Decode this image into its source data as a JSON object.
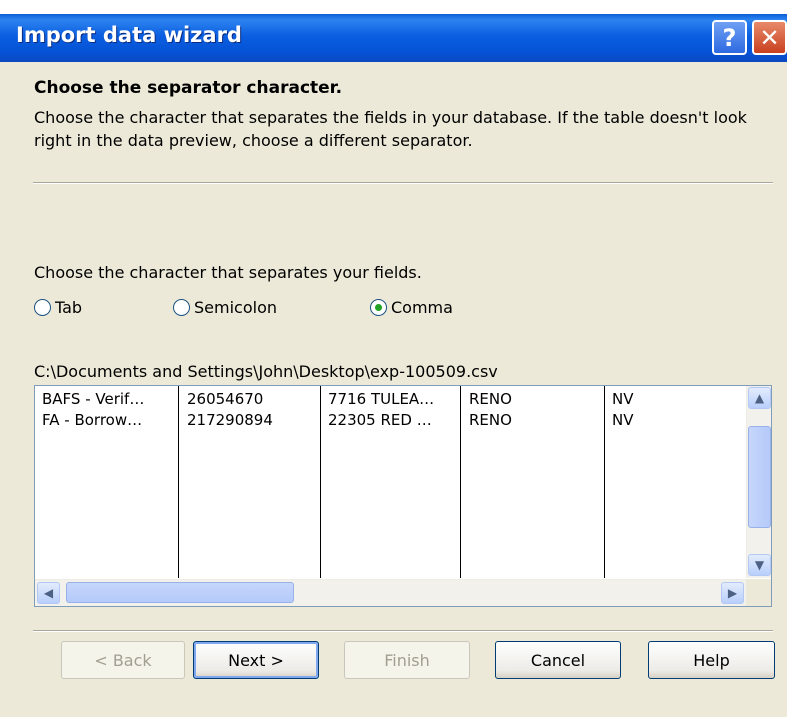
{
  "window": {
    "title": "Import data wizard",
    "help_glyph": "?",
    "close_glyph": "✕",
    "help_icon": "help-icon",
    "close_icon": "close-icon"
  },
  "header": {
    "heading": "Choose the separator character.",
    "description": "Choose the character that separates the fields in your database. If the table doesn't look right in the data preview, choose a different separator."
  },
  "separator": {
    "prompt": "Choose the character that separates your fields.",
    "options": [
      {
        "label": "Tab",
        "selected": false
      },
      {
        "label": "Semicolon",
        "selected": false
      },
      {
        "label": "Comma",
        "selected": true
      }
    ]
  },
  "preview": {
    "file_path": "C:\\Documents and Settings\\John\\Desktop\\exp-100509.csv",
    "rows": [
      [
        "BAFS - Verif…",
        "26054670",
        "7716 TULEA…",
        "RENO",
        "NV"
      ],
      [
        "FA - Borrow…",
        "217290894",
        "22305 RED …",
        "RENO",
        "NV"
      ]
    ],
    "scroll_up_glyph": "▲",
    "scroll_down_glyph": "▼",
    "scroll_left_glyph": "◀",
    "scroll_right_glyph": "▶"
  },
  "buttons": {
    "back": "< Back",
    "next": "Next >",
    "finish": "Finish",
    "cancel": "Cancel",
    "help": "Help"
  },
  "colors": {
    "titlebar": "#0552d6",
    "dialog_bg": "#ece9d8",
    "radio_selected": "#21a121"
  }
}
